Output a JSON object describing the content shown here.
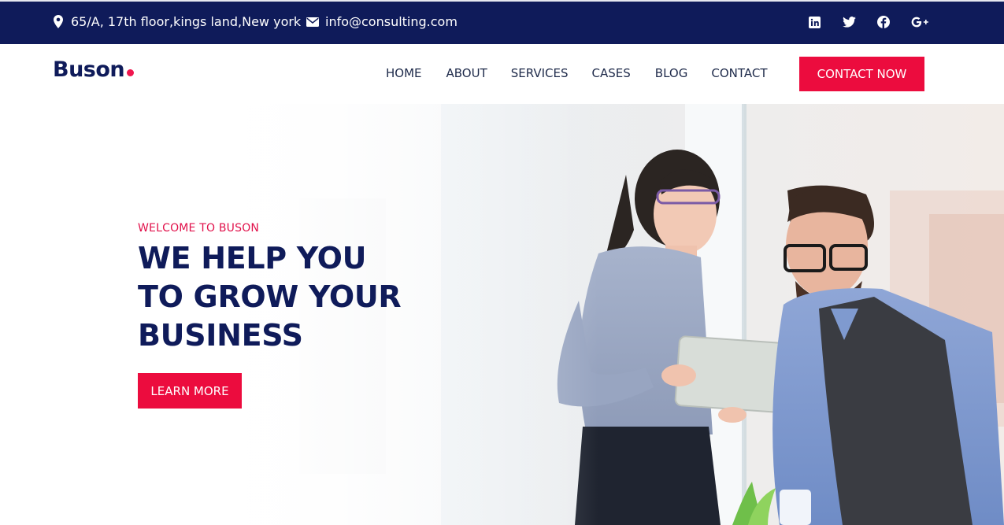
{
  "topbar": {
    "address": "65/A, 17th floor,kings land,New york",
    "email": "info@consulting.com",
    "social": [
      {
        "icon": "linkedin-icon",
        "glyph": "in"
      },
      {
        "icon": "twitter-icon",
        "glyph": "t"
      },
      {
        "icon": "facebook-icon",
        "glyph": "f"
      },
      {
        "icon": "google-plus-icon",
        "glyph": "G+"
      }
    ]
  },
  "brand": {
    "name": "Buson"
  },
  "nav": {
    "items": [
      "HOME",
      "ABOUT",
      "SERVICES",
      "CASES",
      "BLOG",
      "CONTACT"
    ],
    "cta": "CONTACT NOW"
  },
  "hero": {
    "eyebrow": "WELCOME TO BUSON",
    "headline": [
      "WE HELP YOU",
      "TO GROW YOUR",
      "BUSINESS"
    ],
    "button": "LEARN MORE"
  },
  "colors": {
    "navy": "#0f1b5a",
    "accent": "#ec0c3e"
  }
}
